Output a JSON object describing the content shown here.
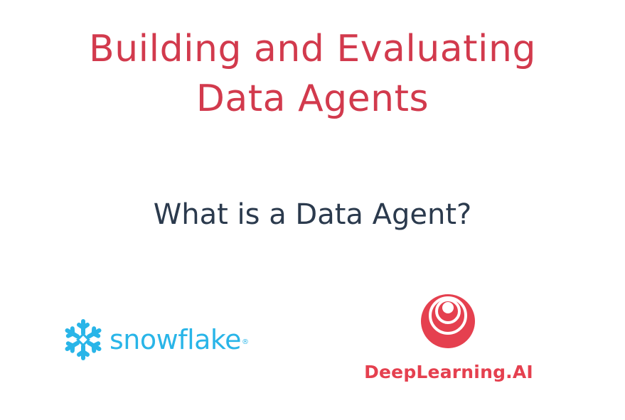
{
  "slide": {
    "title_lines": [
      "Building and Evaluating",
      "Data Agents"
    ],
    "subtitle": "What is a Data Agent?",
    "logos": {
      "snowflake": {
        "wordmark": "snowflake",
        "registered_mark": "®",
        "icon": "snowflake-icon",
        "color": "#29b5e8"
      },
      "deeplearning": {
        "wordmark": "DeepLearning.AI",
        "icon": "deeplearning-ai-icon",
        "color": "#e5404f"
      }
    },
    "colors": {
      "title": "#d23a4d",
      "subtitle": "#2b3a4d",
      "background": "#ffffff"
    }
  }
}
